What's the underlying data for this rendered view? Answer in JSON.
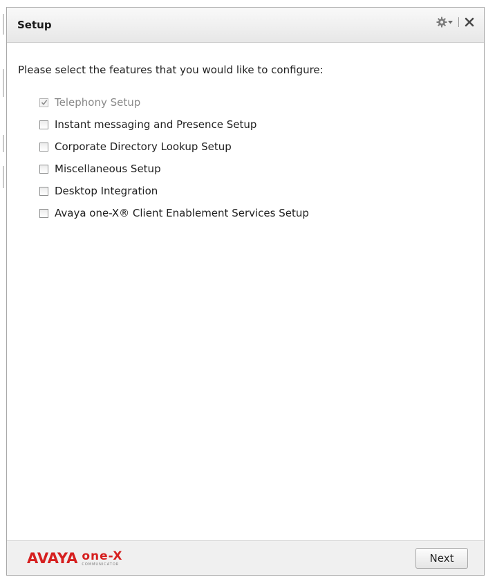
{
  "window": {
    "title": "Setup",
    "controls": {
      "settings_icon": "gear-icon",
      "dropdown_icon": "caret-down-icon",
      "close_icon": "close-icon"
    }
  },
  "prompt": "Please select the features that you would like to configure:",
  "features": [
    {
      "label": "Telephony Setup",
      "checked": true,
      "disabled": true
    },
    {
      "label": "Instant messaging and Presence Setup",
      "checked": false,
      "disabled": false
    },
    {
      "label": "Corporate Directory Lookup Setup",
      "checked": false,
      "disabled": false
    },
    {
      "label": "Miscellaneous Setup",
      "checked": false,
      "disabled": false
    },
    {
      "label": "Desktop Integration",
      "checked": false,
      "disabled": false
    },
    {
      "label": "Avaya one-X® Client Enablement Services Setup",
      "checked": false,
      "disabled": false
    }
  ],
  "footer": {
    "brand": "AVAYA",
    "product": "one-X",
    "product_sub": "COMMUNICATOR",
    "next_label": "Next"
  },
  "colors": {
    "brand_red": "#d62020",
    "check_mark": "#8c8c8c"
  }
}
